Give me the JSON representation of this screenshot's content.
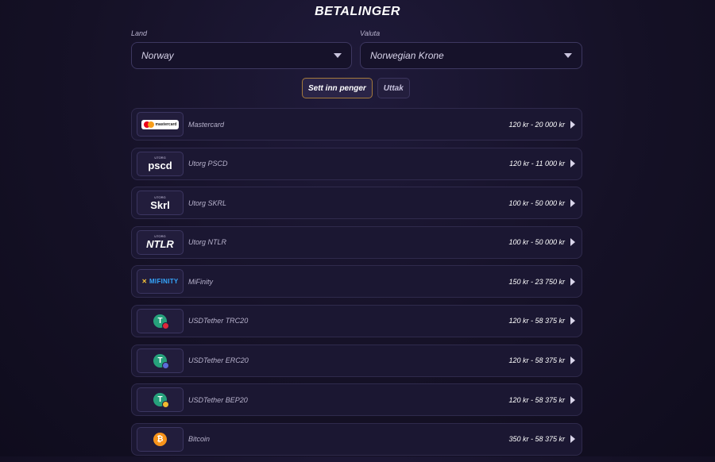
{
  "header": {
    "title": "BETALINGER"
  },
  "filters": {
    "country_label": "Land",
    "country_value": "Norway",
    "currency_label": "Valuta",
    "currency_value": "Norwegian Krone"
  },
  "tabs": [
    {
      "label": "Sett inn penger",
      "active": true
    },
    {
      "label": "Uttak",
      "active": false
    }
  ],
  "methods": [
    {
      "name": "Mastercard",
      "range": "120 kr - 20 000 kr",
      "logo_text": "mastercard",
      "icon": "mastercard-icon"
    },
    {
      "name": "Utorg PSCD",
      "range": "120 kr - 11 000 kr",
      "logo_small": "UTORG",
      "logo_text": "pscd",
      "icon": "pscd-icon"
    },
    {
      "name": "Utorg SKRL",
      "range": "100 kr - 50 000 kr",
      "logo_small": "UTORG",
      "logo_text": "Skrl",
      "icon": "skrill-icon"
    },
    {
      "name": "Utorg NTLR",
      "range": "100 kr - 50 000 kr",
      "logo_small": "UTORG",
      "logo_text": "NTLR",
      "icon": "neteller-icon"
    },
    {
      "name": "MiFinity",
      "range": "150 kr - 23 750 kr",
      "logo_text": "MIFINITY",
      "icon": "mifinity-icon"
    },
    {
      "name": "USDTether TRC20",
      "range": "120 kr - 58 375 kr",
      "logo_text": "T",
      "icon": "usdt-trc20-icon",
      "badge_color": "#e0283a"
    },
    {
      "name": "USDTether ERC20",
      "range": "120 kr - 58 375 kr",
      "logo_text": "T",
      "icon": "usdt-erc20-icon",
      "badge_color": "#5b6bd8"
    },
    {
      "name": "USDTether BEP20",
      "range": "120 kr - 58 375 kr",
      "logo_text": "T",
      "icon": "usdt-bep20-icon",
      "badge_color": "#f3ba2f"
    },
    {
      "name": "Bitcoin",
      "range": "350 kr - 58 375 kr",
      "logo_text": "₿",
      "icon": "bitcoin-icon"
    }
  ],
  "colors": {
    "background": "#151126",
    "row_bg": "#1b1732",
    "active_tab_border": "#a47a3c"
  }
}
